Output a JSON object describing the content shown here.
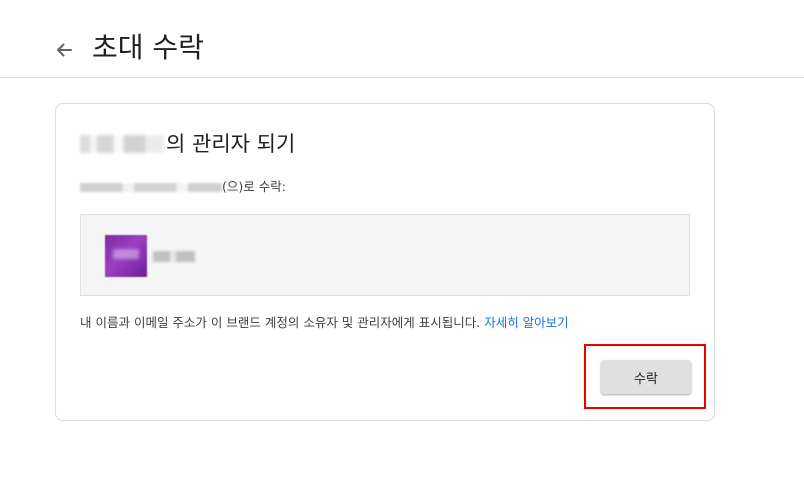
{
  "header": {
    "title": "초대 수락",
    "back_icon": "arrow-left-icon"
  },
  "card": {
    "title_suffix": "의 관리자 되기",
    "accept_as_suffix": "(으)로 수락:",
    "notice_text": "내 이름과 이메일 주소가 이 브랜드 계정의 소유자 및 관리자에게 표시됩니다. ",
    "learn_more_label": "자세히 알아보기",
    "accept_button_label": "수락"
  },
  "colors": {
    "link": "#1a73e8",
    "avatar": "#7b2aa3",
    "highlight": "#ee0000",
    "button_bg": "#e0e0e0"
  }
}
